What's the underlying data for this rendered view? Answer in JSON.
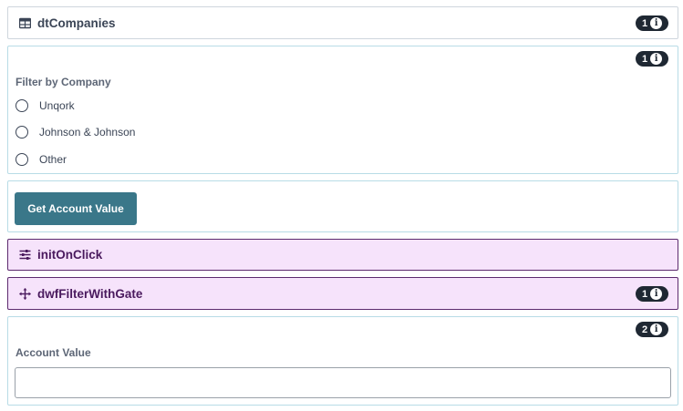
{
  "components": {
    "dtCompanies": {
      "title": "dtCompanies",
      "badge_count": "1",
      "icon": "table-icon"
    },
    "filter": {
      "badge_count": "1",
      "label": "Filter by Company",
      "options": [
        "Unqork",
        "Johnson & Johnson",
        "Other"
      ],
      "selected": null
    },
    "get_value_button": {
      "label": "Get Account Value",
      "color": "#3a7789"
    },
    "initOnClick": {
      "title": "initOnClick",
      "icon": "sliders-icon"
    },
    "dwfFilterWithGate": {
      "title": "dwfFilterWithGate",
      "badge_count": "1",
      "icon": "move-arrows-icon"
    },
    "account_value": {
      "badge_count": "2",
      "label": "Account Value",
      "value": ""
    }
  },
  "badge_info_glyph": "i",
  "colors": {
    "purple_bg": "#f6e3fb",
    "purple_border": "#5c2a6e",
    "button": "#3a7789",
    "badge": "#1f2833"
  }
}
